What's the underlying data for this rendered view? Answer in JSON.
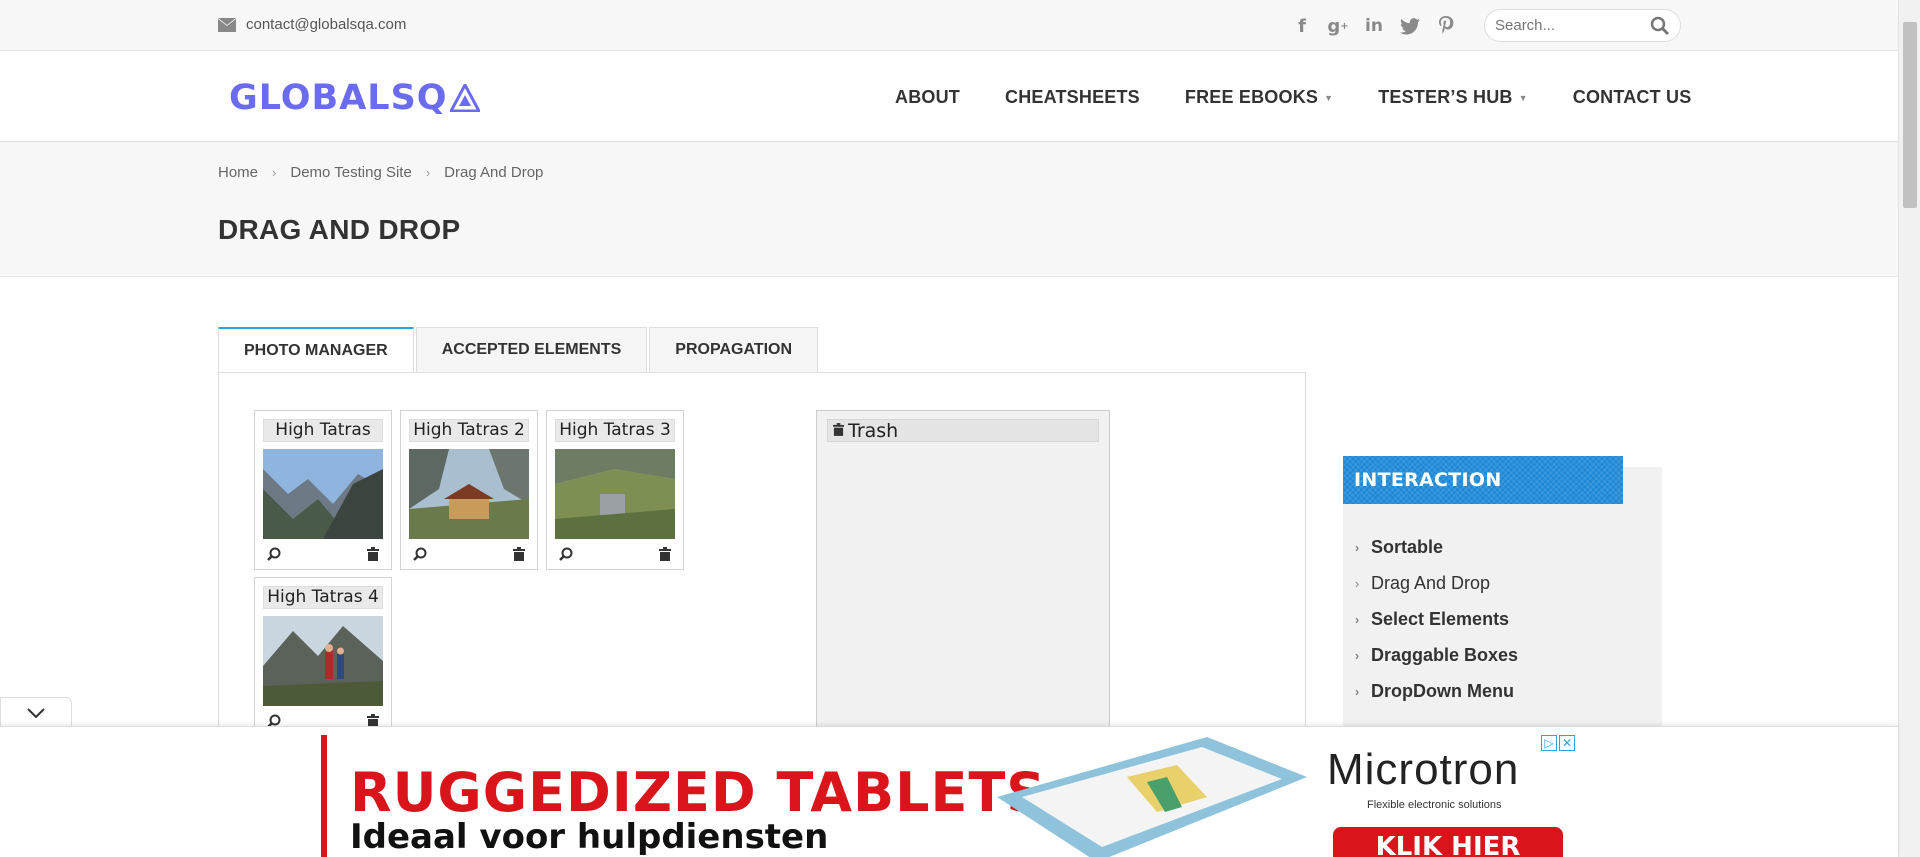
{
  "topbar": {
    "email": "contact@globalsqa.com",
    "social": [
      "facebook-icon",
      "google-plus-icon",
      "linkedin-icon",
      "twitter-icon",
      "pinterest-icon"
    ],
    "search_placeholder": "Search..."
  },
  "header": {
    "logo": "GLOBALSQ",
    "nav": [
      {
        "label": "ABOUT",
        "dropdown": false
      },
      {
        "label": "CHEATSHEETS",
        "dropdown": false
      },
      {
        "label": "FREE EBOOKS",
        "dropdown": true
      },
      {
        "label": "TESTER’S HUB",
        "dropdown": true
      },
      {
        "label": "CONTACT US",
        "dropdown": false
      }
    ]
  },
  "breadcrumb": [
    "Home",
    "Demo Testing Site",
    "Drag And Drop"
  ],
  "page_title": "DRAG AND DROP",
  "tabs": [
    {
      "label": "PHOTO MANAGER",
      "active": true
    },
    {
      "label": "ACCEPTED ELEMENTS",
      "active": false
    },
    {
      "label": "PROPAGATION",
      "active": false
    }
  ],
  "gallery": {
    "photos": [
      {
        "title": "High Tatras"
      },
      {
        "title": "High Tatras 2"
      },
      {
        "title": "High Tatras 3"
      },
      {
        "title": "High Tatras 4"
      }
    ],
    "trash_title": "Trash"
  },
  "sidebar": {
    "title": "INTERACTION",
    "items": [
      {
        "label": "Sortable"
      },
      {
        "label": "Drag And Drop"
      },
      {
        "label": "Select Elements"
      },
      {
        "label": "Draggable Boxes"
      },
      {
        "label": "DropDown Menu"
      }
    ]
  },
  "ad": {
    "headline": "RUGGEDIZED TABLETS",
    "subline": "Ideaal voor hulpdiensten",
    "brand": "Microtron",
    "tagline": "Flexible electronic solutions",
    "cta": "KLIK HIER"
  },
  "colors": {
    "accent": "#29a6e0",
    "logo": "#6b6bf0",
    "widget_title_bg": "#1a87d6",
    "ad_red": "#d9151b"
  }
}
